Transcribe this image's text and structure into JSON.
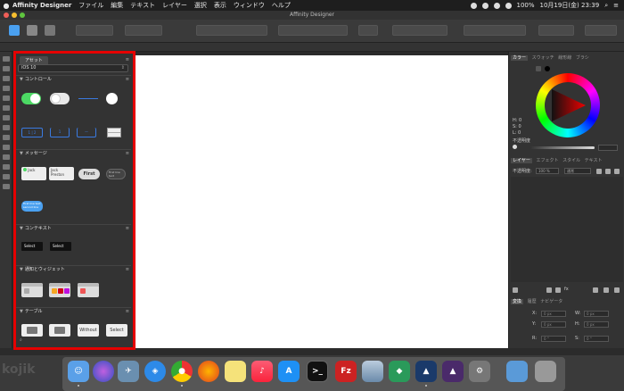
{
  "menubar": {
    "app_name": "Affinity Designer",
    "items": [
      "ファイル",
      "編集",
      "テキスト",
      "レイヤー",
      "選択",
      "表示",
      "ウィンドウ",
      "ヘルプ"
    ],
    "battery": "100%",
    "datetime": "10月19日(金)  23:39"
  },
  "window": {
    "title": "Affinity Designer"
  },
  "assets_panel": {
    "tab_label": "アセット",
    "dropdown_value": "iOS 10",
    "dropdown_arrow": "⇕",
    "categories": {
      "controls": "コントロール",
      "messages": "メッセージ",
      "context": "コンテキスト",
      "notifications": "通知とウィジェット",
      "tables": "テーブル"
    },
    "message_texts": {
      "m1": "Jack",
      "m2": "Jack Preston",
      "m3": "First",
      "m4": "First line text second line",
      "m5": "First line text second line"
    },
    "context_buttons": [
      "Select",
      "Select"
    ],
    "table_labels": [
      "Without",
      "Select"
    ],
    "footer_search": "⌕"
  },
  "right_panel": {
    "color_tabs": [
      "カラー",
      "スウォッチ",
      "線形線",
      "ブラシ"
    ],
    "h_label": "H: 0",
    "s_label": "S: 0",
    "l_label": "L: 0",
    "opacity_label": "不透明度",
    "layer_tabs": [
      "レイヤー",
      "エフェクト",
      "スタイル",
      "テキスト"
    ],
    "layer_opacity_label": "不透明度:",
    "layer_opacity_value": "100 %",
    "layer_blend_value": "通常",
    "transform_tabs": [
      "変換",
      "履歴",
      "ナビゲータ"
    ],
    "transform": {
      "x_label": "X:",
      "y_label": "Y:",
      "w_label": "W:",
      "h_label": "H:",
      "r_label": "R:",
      "s_label": "S:",
      "x_value": "0 px",
      "y_value": "0 px",
      "w_value": "0 px",
      "h_value": "0 px",
      "r_value": "0 °",
      "s_value": "0 °"
    }
  },
  "dock": {
    "watermark": "kojik"
  },
  "colors": {
    "highlight": "#e50000",
    "accent_blue": "#3a7ae0",
    "toggle_green": "#4cd964"
  }
}
